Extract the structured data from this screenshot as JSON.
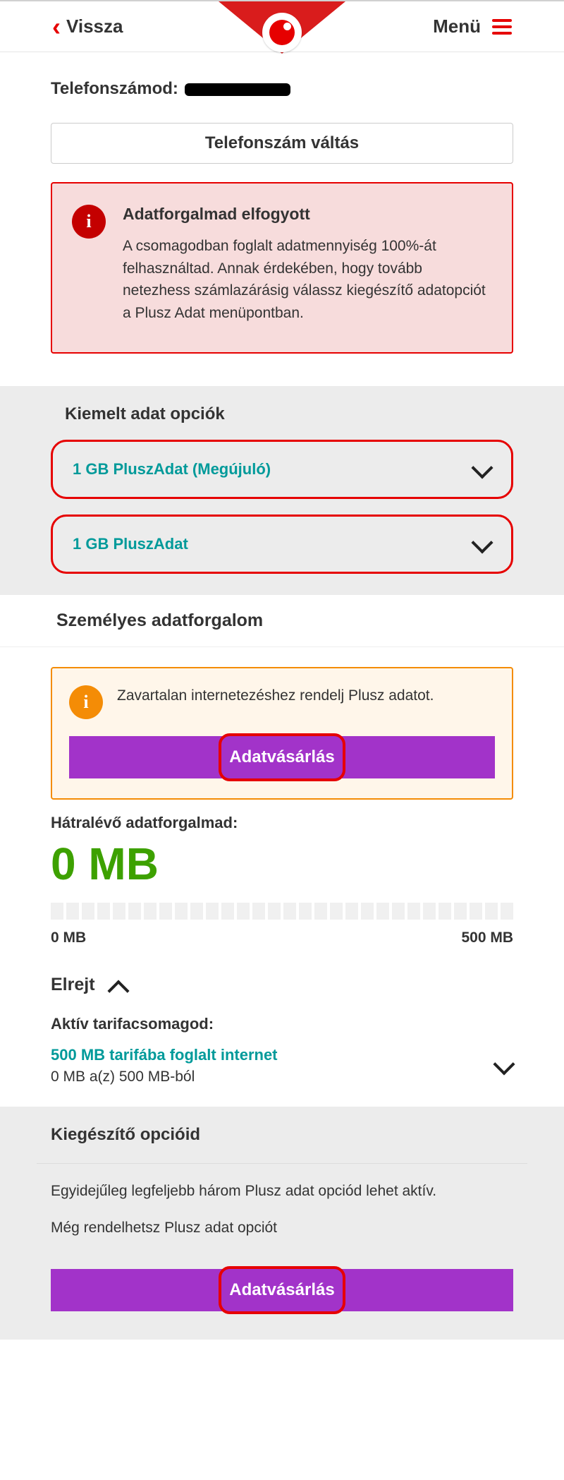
{
  "header": {
    "back_label": "Vissza",
    "menu_label": "Menü"
  },
  "phone": {
    "label_prefix": "Telefonszámod: ",
    "switch_button": "Telefonszám váltás"
  },
  "alert_data_out": {
    "title": "Adatforgalmad elfogyott",
    "body": "A csomagodban foglalt adatmennyiség 100%-át felhasználtad. Annak érdekében, hogy tovább netezhess számlazárásig válassz kiegészítő adatopciót a Plusz Adat menüpontban."
  },
  "featured": {
    "title": "Kiemelt adat opciók",
    "items": [
      {
        "label": "1 GB PluszAdat (Megújuló)"
      },
      {
        "label": "1 GB PluszAdat"
      }
    ]
  },
  "personal": {
    "title": "Személyes adatforgalom",
    "order_hint": "Zavartalan internetezéshez rendelj Plusz adatot.",
    "buy_button": "Adatvásárlás",
    "remaining_label": "Hátralévő adatforgalmad:",
    "remaining_value": "0 MB",
    "range_min": "0 MB",
    "range_max": "500 MB",
    "hide_label": "Elrejt",
    "active_plan_label": "Aktív tarifacsomagod:",
    "tariff_title": "500 MB tarifába foglalt internet",
    "tariff_sub": "0 MB a(z) 500 MB-ból"
  },
  "addons": {
    "title": "Kiegészítő opcióid",
    "line1": "Egyidejűleg legfeljebb három Plusz adat opciód lehet aktív.",
    "line2": "Még rendelhetsz Plusz adat opciót",
    "buy_button": "Adatvásárlás"
  }
}
